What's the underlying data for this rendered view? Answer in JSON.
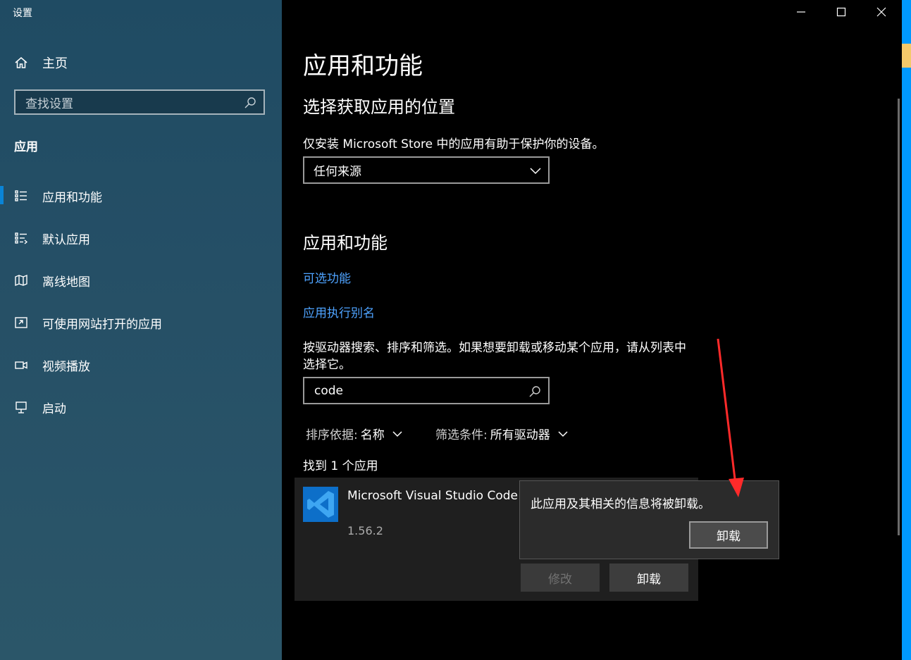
{
  "window": {
    "title": "设置"
  },
  "sidebar": {
    "home_label": "主页",
    "search_placeholder": "查找设置",
    "section": "应用",
    "items": [
      {
        "label": "应用和功能",
        "icon": "apps-list-icon",
        "active": true
      },
      {
        "label": "默认应用",
        "icon": "default-apps-icon",
        "active": false
      },
      {
        "label": "离线地图",
        "icon": "map-icon",
        "active": false
      },
      {
        "label": "可使用网站打开的应用",
        "icon": "website-apps-icon",
        "active": false
      },
      {
        "label": "视频播放",
        "icon": "video-icon",
        "active": false
      },
      {
        "label": "启动",
        "icon": "startup-icon",
        "active": false
      }
    ]
  },
  "main": {
    "title": "应用和功能",
    "choose_location": {
      "heading": "选择获取应用的位置",
      "description": "仅安装 Microsoft Store 中的应用有助于保护你的设备。",
      "dropdown_value": "任何来源"
    },
    "apps_section": {
      "heading": "应用和功能",
      "link_optional": "可选功能",
      "link_alias": "应用执行别名",
      "description_line1": "按驱动器搜索、排序和筛选。如果想要卸载或移动某个应用，请从列表中",
      "description_line2": "选择它。",
      "search_value": "code",
      "sort_label": "排序依据:",
      "sort_value": "名称",
      "filter_label": "筛选条件:",
      "filter_value": "所有驱动器",
      "found_text": "找到 1 个应用"
    },
    "app": {
      "name": "Microsoft Visual Studio Code",
      "version": "1.56.2",
      "modify_label": "修改",
      "uninstall_label": "卸载"
    },
    "flyout": {
      "message": "此应用及其相关的信息将被卸载。",
      "confirm_label": "卸载"
    }
  },
  "colors": {
    "accent": "#0a84d6",
    "link": "#4ea3ff",
    "annotation_arrow": "#ff2a2a"
  }
}
